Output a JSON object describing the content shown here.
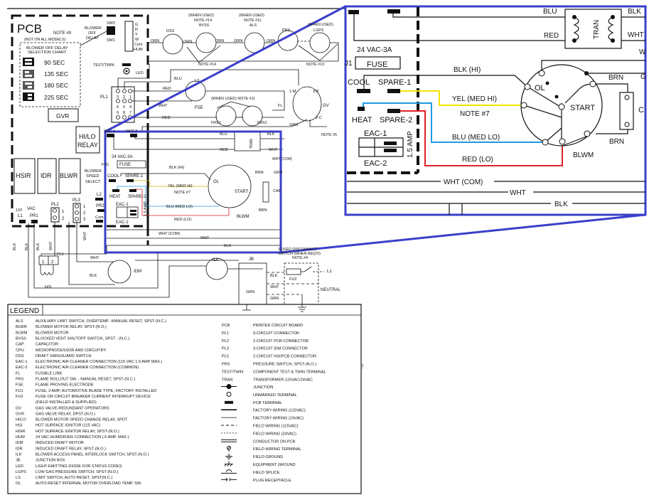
{
  "colors": {
    "zoom_frame": "#3b3fc9",
    "yellow_wire": "#f2e400",
    "blue_wire": "#1c9be0",
    "red_wire": "#e0202a"
  },
  "diagram": {
    "main_labels": [
      "PCB",
      "NOTE #9",
      "(NOT ON ALL MODELS)",
      "BLOWER OFF DELAY",
      "SELECTION CHART",
      "90   SEC",
      "135 SEC",
      "180 SEC",
      "225 SEC",
      "GVR",
      "BLOWER",
      "OFF",
      "DELAY",
      "SW2",
      "SW1",
      "G",
      "R",
      "Y",
      "W",
      "Com",
      "HUM",
      "TEST/TWIN",
      "LED",
      "PL1",
      "3",
      "2",
      "1",
      "6",
      "5",
      "4",
      "9",
      "8",
      "7",
      "HI/LO",
      "RELAY",
      "SEC-1",
      "SEC-2",
      "HSIR",
      "IDR",
      "BLWR",
      "BLOWER",
      "SPEED",
      "SELECT",
      "120",
      "VAC",
      "L1",
      "PR1",
      "PL2",
      "1",
      "2",
      "PL3",
      "1",
      "2",
      "3",
      "L2",
      "PR2",
      "Com",
      "BLK",
      "BLK",
      "BLK",
      "WHT",
      "WHT",
      "WHT",
      "BLK",
      "PL5",
      "1",
      "2",
      "HSI",
      "IDM",
      "ORN",
      "DSS",
      "(WHEN USED)",
      "NOTE #14",
      "BVSS",
      "ORN",
      "ORN",
      "(WHEN USED)",
      "NOTE #11",
      "ALS",
      "ORN",
      "ORN",
      "PRS",
      "(WHEN USED)",
      "LGPS",
      "NOTE #14",
      "NOTE #13",
      "BLU",
      "LS",
      "RED",
      "(WHEN USED) NOTE #11",
      "WHT",
      "FSE",
      "RED",
      "FRS1",
      "FRS2",
      "FL",
      "1-M",
      "3-P",
      "GV",
      "2-C",
      "GRN",
      "NOTE #5",
      "BLU",
      "BLK",
      "RED",
      "WHT",
      "TRAN",
      "WHT (COM)",
      "24 VAC-3A",
      "FU1",
      "FUSE",
      "BLK (HI)",
      "BRN",
      "GRN",
      "COOL",
      "SPARE-1",
      "YEL (MED HI)",
      "NOTE #7",
      "OL",
      "START",
      "CAP",
      "HEAT",
      "SPARE-2",
      "EAC-1",
      "EAC-2",
      "1.5 AMP",
      "BLU (MED LO)",
      "BRN",
      "RED (LO)",
      "BLWM",
      "WHT (COM)",
      "WHT",
      "BLK",
      "ILK",
      "JB",
      "FUSED DISCONNECT",
      "SWITCH (WHEN REQ'D)",
      "NOTE #4",
      "BLK",
      "WHT",
      "GRN",
      "GRN",
      "FU2",
      "L1",
      "NEUTRAL"
    ],
    "zoom_labels": [
      "BLU",
      "RED",
      "TRAN",
      "BLK",
      "WHT",
      "24 VAC-3A",
      "J1",
      "FUSE",
      "COOL",
      "SPARE-1",
      "HEAT",
      "SPARE-2",
      "EAC-1",
      "EAC-2",
      "1.5 AMP",
      "BLK  (HI)",
      "YEL (MED HI)",
      "NOTE #7",
      "BLU (MED LO)",
      "RED   (LO)",
      "OL",
      "START",
      "BRN",
      "BRN",
      "C",
      "BLWM",
      "W",
      "G",
      "WHT   (COM)",
      "WHT",
      "BLK"
    ]
  },
  "legend": {
    "title": "LEGEND",
    "left": [
      [
        "ALS",
        "AUXILIARY LIMIT SWITCH, OVERTEMP. -MANUAL RESET, SPST-(N.C.)"
      ],
      [
        "BLWR",
        "BLOWER MOTOR RELAY, SPST-(N.O.)"
      ],
      [
        "BLWM",
        "BLOWER MOTOR"
      ],
      [
        "BVSS",
        "BLOCKED VENT SHUTOFF SWITCH, SPST - (N.C.)"
      ],
      [
        "CAP",
        "CAPACITOR"
      ],
      [
        "CPU",
        "MICROPROCESSOR AND CIRCUITRY"
      ],
      [
        "DSS",
        "DRAFT SAFEGUARD SWITCH"
      ],
      [
        "EAC-1",
        "ELECTRONIC AIR CLEANER CONNECTION (115 VAC 1.5 AMP MAX.)"
      ],
      [
        "EAC-2",
        "ELECTRONIC AIR CLEANER CONNECTION (COMMON)"
      ],
      [
        "FL",
        "FUSIBLE LINK"
      ],
      [
        "FRS",
        "FLAME ROLLOUT SW. - MANUAL RESET, SPST-(N.C.)"
      ],
      [
        "FSE",
        "FLAME PROVING ELECTRODE"
      ],
      [
        "FU1",
        "FUSE, 3 AMP, AUTOMOTIVE BLADE TYPE, FACTORY INSTALLED"
      ],
      [
        "FU2",
        "FUSE OR CIRCUIT BREAKER CURRENT INTERRUPT DEVICE"
      ],
      [
        "",
        "(FIELD INSTALLED & SUPPLIED)"
      ],
      [
        "GV",
        "GAS VALVE-REDUNDANT OPERATORS"
      ],
      [
        "GVR",
        "GAS VALVE RELAY, DPST-(N.O.)"
      ],
      [
        "HI/LO",
        "BLOWER MOTOR SPEED CHANGE RELAY, SPDT"
      ],
      [
        "HSI",
        "HOT SURFACE IGNITOR (115 VAC)"
      ],
      [
        "HSIR",
        "HOT SURFACE IGNITOR RELAY, SPST-(N.O.)"
      ],
      [
        "HUM",
        "24 VAC HUMIDIFIER CONNECTION (.5 AMP. MAX.)"
      ],
      [
        "IDM",
        "INDUCED DRAFT MOTOR"
      ],
      [
        "IDR",
        "INDUCED DRAFT RELAY, SPST-(N.O.)"
      ],
      [
        "ILK",
        "BLOWER ACCESS PANEL INTERLOCK SWITCH, SPST-(N.O.)"
      ],
      [
        "JB",
        "JUNCTION BOX"
      ],
      [
        "LED",
        "LIGHT-EMITTING DIODE FOR STATUS CODES"
      ],
      [
        "LGPS",
        "LOW GAS PRESSURE SWITCH, SPST-(N.O.)"
      ],
      [
        "LS",
        "LIMIT SWITCH, AUTO RESET, SPST(N.C.)"
      ],
      [
        "OL",
        "AUTO-RESET INTERNAL MOTOR OVERLOAD TEMP. SW."
      ]
    ],
    "right": [
      [
        "PCB",
        "PRINTED CIRCUIT BOARD"
      ],
      [
        "PL1",
        "9-CIRCUIT CONNECTOR"
      ],
      [
        "PL2",
        "2-CIRCUIT PCB CONNECTOR"
      ],
      [
        "PL3",
        "3-CIRCUIT IDM CONNECTOR"
      ],
      [
        "PL5",
        "2-CIRCUIT HSI/PCB CONNECTOR"
      ],
      [
        "PRS",
        "PRESSURE SWITCH, SPST-(N.O.)"
      ],
      [
        "TEST/TWIN",
        "COMPONENT TEST & TWIN TERMINAL"
      ],
      [
        "TRAN",
        "TRANSFORMER-115VAC/24VAC"
      ]
    ],
    "symbols": [
      [
        "junction",
        "JUNCTION"
      ],
      [
        "unmarked-terminal",
        "UNMARKED TERMINAL"
      ],
      [
        "pcb-terminal",
        "PCB TERMINAL"
      ],
      [
        "factory-wiring-115",
        "FACTORY WIRING (115VAC)"
      ],
      [
        "factory-wiring-24",
        "FACTORY WIRING (24VAC)"
      ],
      [
        "field-wiring-115",
        "FIELD WIRING (115VAC)"
      ],
      [
        "field-wiring-24",
        "FIELD WIRING (24VAC)"
      ],
      [
        "conductor-on-pcb",
        "CONDUCTOR ON PCB"
      ],
      [
        "field-wiring-terminal",
        "FIELD WIRING TERMINAL"
      ],
      [
        "field-ground",
        "FIELD GROUND"
      ],
      [
        "equipment-ground",
        "EQUIPMENT GROUND"
      ],
      [
        "field-splice",
        "FIELD SPLICE"
      ],
      [
        "plug-receptacle",
        "PLUG RECEPTACLE"
      ]
    ]
  }
}
